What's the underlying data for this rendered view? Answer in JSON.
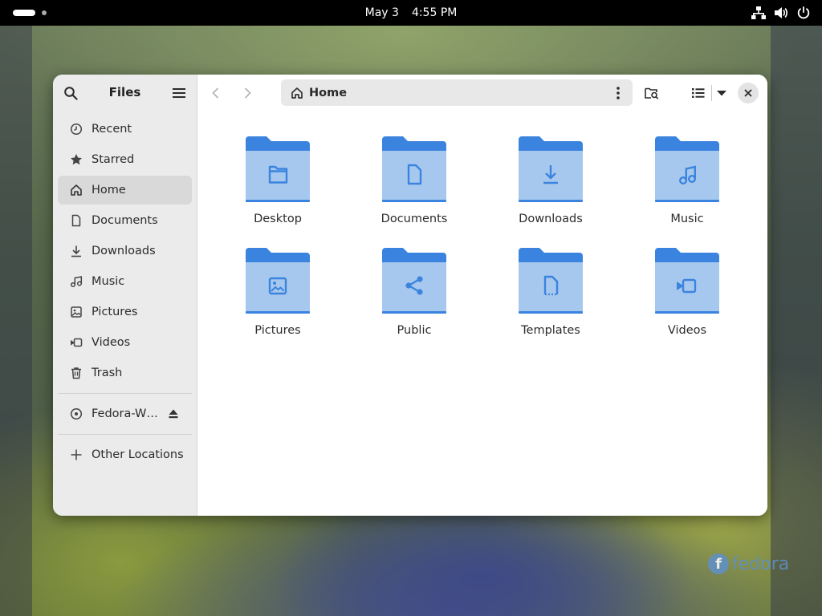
{
  "topbar": {
    "date": "May 3",
    "time": "4:55 PM",
    "tray_icons": [
      "network-icon",
      "volume-icon",
      "power-icon"
    ]
  },
  "window": {
    "sidebar": {
      "title": "Files",
      "items": [
        {
          "label": "Recent",
          "icon": "clock-icon",
          "active": false
        },
        {
          "label": "Starred",
          "icon": "star-icon",
          "active": false
        },
        {
          "label": "Home",
          "icon": "home-icon",
          "active": true
        },
        {
          "label": "Documents",
          "icon": "document-icon",
          "active": false
        },
        {
          "label": "Downloads",
          "icon": "download-icon",
          "active": false
        },
        {
          "label": "Music",
          "icon": "music-icon",
          "active": false
        },
        {
          "label": "Pictures",
          "icon": "picture-icon",
          "active": false
        },
        {
          "label": "Videos",
          "icon": "video-icon",
          "active": false
        },
        {
          "label": "Trash",
          "icon": "trash-icon",
          "active": false
        }
      ],
      "devices": [
        {
          "label": "Fedora-W…",
          "icon": "disc-icon"
        }
      ],
      "other_locations": "Other Locations"
    },
    "pathbar": {
      "location": "Home"
    },
    "folders": [
      {
        "name": "Desktop",
        "emblem": "folder"
      },
      {
        "name": "Documents",
        "emblem": "document"
      },
      {
        "name": "Downloads",
        "emblem": "download"
      },
      {
        "name": "Music",
        "emblem": "music"
      },
      {
        "name": "Pictures",
        "emblem": "picture"
      },
      {
        "name": "Public",
        "emblem": "share"
      },
      {
        "name": "Templates",
        "emblem": "template"
      },
      {
        "name": "Videos",
        "emblem": "video"
      }
    ]
  },
  "colors": {
    "folder_back": "#3a84df",
    "folder_front": "#a7c8ee",
    "emblem": "#3a84df"
  },
  "wallpaper_logo": "fedora"
}
